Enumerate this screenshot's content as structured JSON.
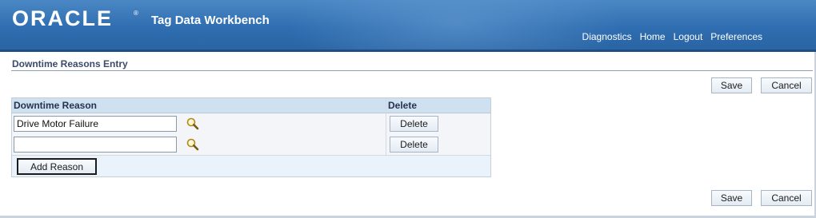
{
  "header": {
    "logo": "ORACLE",
    "logo_reg": "®",
    "app_title": "Tag Data Workbench",
    "links": {
      "diagnostics": "Diagnostics",
      "home": "Home",
      "logout": "Logout",
      "preferences": "Preferences"
    }
  },
  "page": {
    "title": "Downtime Reasons Entry",
    "save_label": "Save",
    "cancel_label": "Cancel"
  },
  "table": {
    "columns": {
      "reason": "Downtime Reason",
      "delete": "Delete"
    },
    "rows": [
      {
        "reason": "Drive Motor Failure",
        "delete_label": "Delete"
      },
      {
        "reason": "",
        "delete_label": "Delete"
      }
    ],
    "add_label": "Add Reason"
  },
  "icons": {
    "lov": "magnifier-search-icon"
  }
}
